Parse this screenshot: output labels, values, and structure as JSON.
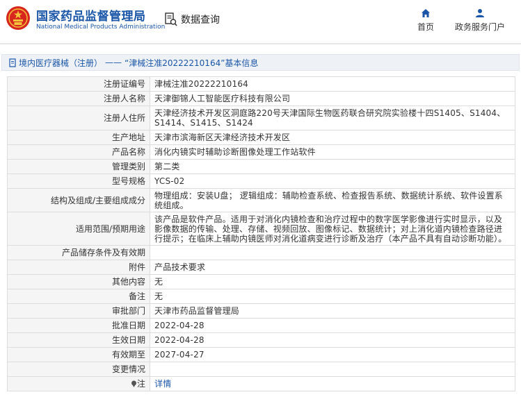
{
  "header": {
    "brand_cn": "国家药品监督管理局",
    "brand_en": "National Medical Products Administration",
    "data_query": "数据查询",
    "nav_home": "首页",
    "nav_gov": "政务服务门户"
  },
  "breadcrumb": {
    "part1": "境内医疗器械（注册）",
    "sep": "——",
    "part2": "“津械注准20222210164”基本信息"
  },
  "rows": [
    {
      "label": "注册证编号",
      "value": "津械注准20222210164"
    },
    {
      "label": "注册人名称",
      "value": "天津御锦人工智能医疗科技有限公司"
    },
    {
      "label": "注册人住所",
      "value": "天津经济技术开发区洞庭路220号天津国际生物医药联合研究院实验楼十四S1405、S1404、S1414、S1415、S1424"
    },
    {
      "label": "生产地址",
      "value": "天津市滨海新区天津经济技术开发区"
    },
    {
      "label": "产品名称",
      "value": "消化内镜实时辅助诊断图像处理工作站软件"
    },
    {
      "label": "管理类别",
      "value": "第二类"
    },
    {
      "label": "型号规格",
      "value": "YCS-02"
    },
    {
      "label": "结构及组成/主要组成成分",
      "value": "物理组成：安装U盘； 逻辑组成：辅助检查系统、检查报告系统、数据统计系统、软件设置系统组成。"
    },
    {
      "label": "适用范围/预期用途",
      "value": "该产品是软件产品。适用于对消化内镜检查和治疗过程中的数字医学影像进行实时显示，以及影像数据的传输、处理、存储、视频回放、图像标记、数据统计；对上消化道内镜检查路径进行提示；在临床上辅助内镜医师对消化道病变进行诊断及治疗（本产品不具有自动诊断功能）。"
    },
    {
      "label": "产品储存条件及有效期",
      "value": ""
    },
    {
      "label": "附件",
      "value": "产品技术要求"
    },
    {
      "label": "其他内容",
      "value": "无"
    },
    {
      "label": "备注",
      "value": "无"
    },
    {
      "label": "审批部门",
      "value": "天津市药品监督管理局"
    },
    {
      "label": "批准日期",
      "value": "2022-04-28"
    },
    {
      "label": "生效日期",
      "value": "2022-04-28"
    },
    {
      "label": "有效期至",
      "value": "2027-04-27"
    },
    {
      "label": "变更情况",
      "value": ""
    }
  ],
  "note_row": {
    "label": "注",
    "link": "详情"
  },
  "colors": {
    "brand_blue": "#1a56a8",
    "emblem_red": "#d7261e",
    "emblem_gold": "#f3c13a"
  },
  "icons": [
    "national-emblem-icon",
    "data-query-icon",
    "home-icon",
    "user-icon",
    "document-icon",
    "pin-icon"
  ]
}
